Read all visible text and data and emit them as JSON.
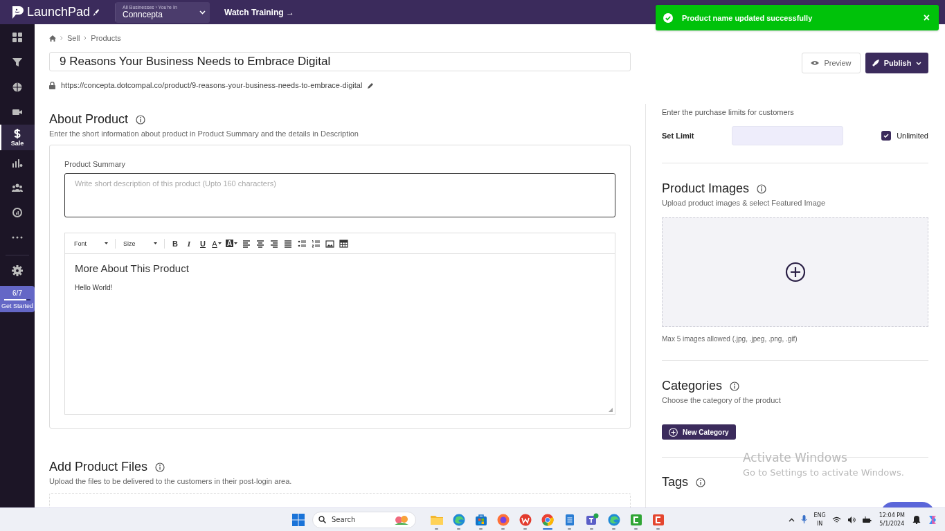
{
  "top_bar": {
    "logo": "LaunchPad",
    "business_switcher": {
      "caption": "All Businesses › You're In",
      "value": "Conncepta"
    },
    "training_link": "Watch Training →"
  },
  "toast": {
    "message": "Product name updated successfully",
    "close": "×"
  },
  "sidebar": {
    "items": [
      {
        "kind": "grid",
        "selected": false
      },
      {
        "kind": "funnel",
        "selected": false
      },
      {
        "kind": "globe",
        "selected": false
      },
      {
        "kind": "video",
        "selected": false
      },
      {
        "kind": "dollar",
        "label": "Sale",
        "selected": true
      },
      {
        "kind": "chart",
        "selected": false
      },
      {
        "kind": "people",
        "selected": false
      },
      {
        "kind": "gauge",
        "selected": false
      },
      {
        "kind": "dots",
        "selected": false
      }
    ],
    "footer_items": [
      {
        "kind": "gear",
        "selected": false
      }
    ],
    "get_started": {
      "count": "6/7",
      "level": 0.85,
      "label": "Get Started"
    }
  },
  "breadcrumb": [
    "Sell",
    "Products"
  ],
  "product": {
    "title": "9 Reasons Your Business Needs to Embrace Digital",
    "url": "https://concepta.dotcompal.co/product/9-reasons-your-business-needs-to-embrace-digital"
  },
  "actions": [
    {
      "kind": "preview",
      "label": "Preview"
    },
    {
      "kind": "publish",
      "label": "Publish"
    }
  ],
  "about": {
    "title": "About Product",
    "subtitle": "Enter the short information about product in Product Summary and the details in Description",
    "summary_label": "Product Summary",
    "summary_placeholder": "Write short description of this product (Upto 160 characters)",
    "editor": {
      "toolbar": [
        {
          "kind": "dropdown",
          "label": "Font"
        },
        {
          "kind": "dropdown",
          "label": "Size"
        },
        {
          "kind": "bold",
          "label": "B"
        },
        {
          "kind": "italic",
          "label": "I"
        },
        {
          "kind": "underline",
          "label": "U"
        },
        {
          "kind": "color",
          "label": "A"
        },
        {
          "kind": "highlight",
          "label": "A"
        },
        {
          "kind": "align-left"
        },
        {
          "kind": "align-center"
        },
        {
          "kind": "align-right"
        },
        {
          "kind": "justify"
        },
        {
          "kind": "bullets"
        },
        {
          "kind": "numbers"
        },
        {
          "kind": "image"
        },
        {
          "kind": "table"
        }
      ],
      "heading": "More About This Product",
      "body": "Hello World!"
    }
  },
  "files": {
    "title": "Add Product Files",
    "subtitle": "Upload the files to be delivered to the customers in their post-login area."
  },
  "purchase_limit": {
    "hint": "Enter the purchase limits for customers",
    "label": "Set Limit",
    "unlimited": {
      "label": "Unlimited",
      "checked": true
    }
  },
  "images": {
    "title": "Product Images",
    "subtitle": "Upload product images & select Featured Image",
    "note": "Max 5 images allowed (.jpg, .jpeg, .png, .gif)"
  },
  "categories": {
    "title": "Categories",
    "subtitle": "Choose the category of the product",
    "button": "New Category"
  },
  "tags": {
    "title": "Tags"
  },
  "activation_notice": {
    "title": "Activate Windows",
    "subtitle": "Go to Settings to activate Windows."
  },
  "taskbar": {
    "search_placeholder": "Search",
    "apps": [
      {
        "kind": "folder",
        "active": false
      },
      {
        "kind": "edge",
        "active": false
      },
      {
        "kind": "store",
        "active": false
      },
      {
        "kind": "firefox",
        "active": false
      },
      {
        "kind": "office",
        "active": false
      },
      {
        "kind": "chrome",
        "active": true
      },
      {
        "kind": "notepad",
        "active": false
      },
      {
        "kind": "teams",
        "active": false
      },
      {
        "kind": "edge",
        "active": false
      },
      {
        "kind": "recorder-green",
        "active": false
      },
      {
        "kind": "recorder-red",
        "active": false
      }
    ],
    "tray": {
      "language": "ENG",
      "region": "IN",
      "time": "12:04 PM",
      "date": "5/1/2024"
    }
  }
}
